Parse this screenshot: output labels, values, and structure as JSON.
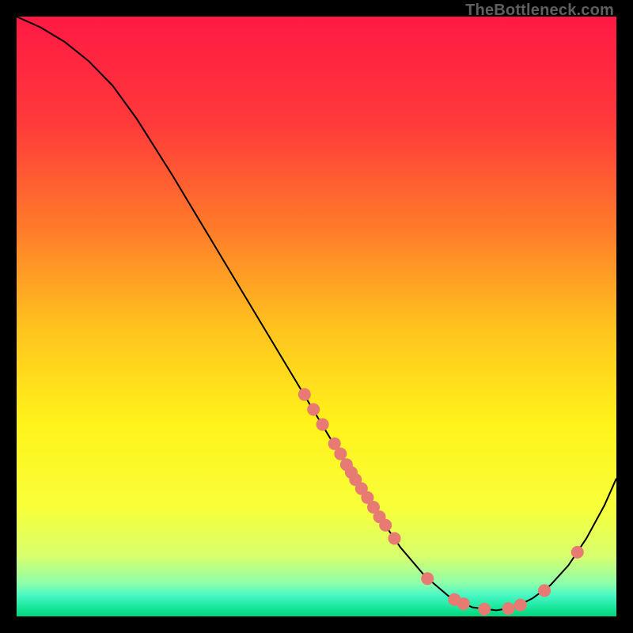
{
  "attribution": "TheBottleneck.com",
  "chart_data": {
    "type": "line",
    "title": "",
    "xlabel": "",
    "ylabel": "",
    "xlim": [
      0,
      100
    ],
    "ylim": [
      0,
      100
    ],
    "background_gradient": {
      "stops": [
        {
          "offset": 0.0,
          "color": "#ff1944"
        },
        {
          "offset": 0.18,
          "color": "#ff3a3a"
        },
        {
          "offset": 0.35,
          "color": "#ff7a2a"
        },
        {
          "offset": 0.52,
          "color": "#ffc31e"
        },
        {
          "offset": 0.68,
          "color": "#fff31a"
        },
        {
          "offset": 0.82,
          "color": "#f7ff3a"
        },
        {
          "offset": 0.9,
          "color": "#d7ff6e"
        },
        {
          "offset": 0.945,
          "color": "#8dffab"
        },
        {
          "offset": 0.965,
          "color": "#49f7c4"
        },
        {
          "offset": 0.983,
          "color": "#1de9a0"
        },
        {
          "offset": 1.0,
          "color": "#00d67a"
        }
      ]
    },
    "curve": [
      {
        "x": 0.0,
        "y": 100.0
      },
      {
        "x": 4.0,
        "y": 98.2
      },
      {
        "x": 8.0,
        "y": 95.8
      },
      {
        "x": 12.0,
        "y": 92.6
      },
      {
        "x": 16.0,
        "y": 88.5
      },
      {
        "x": 20.0,
        "y": 83.0
      },
      {
        "x": 26.0,
        "y": 73.5
      },
      {
        "x": 32.0,
        "y": 63.5
      },
      {
        "x": 38.0,
        "y": 53.5
      },
      {
        "x": 44.0,
        "y": 43.5
      },
      {
        "x": 50.0,
        "y": 33.5
      },
      {
        "x": 55.0,
        "y": 25.2
      },
      {
        "x": 60.0,
        "y": 17.3
      },
      {
        "x": 64.0,
        "y": 11.5
      },
      {
        "x": 68.0,
        "y": 6.8
      },
      {
        "x": 72.0,
        "y": 3.4
      },
      {
        "x": 76.0,
        "y": 1.5
      },
      {
        "x": 80.0,
        "y": 1.0
      },
      {
        "x": 83.0,
        "y": 1.5
      },
      {
        "x": 86.0,
        "y": 3.0
      },
      {
        "x": 89.0,
        "y": 5.2
      },
      {
        "x": 92.0,
        "y": 8.5
      },
      {
        "x": 95.0,
        "y": 13.0
      },
      {
        "x": 98.0,
        "y": 18.5
      },
      {
        "x": 100.0,
        "y": 23.0
      }
    ],
    "points": [
      {
        "x": 48.0,
        "y": 37.0
      },
      {
        "x": 49.5,
        "y": 34.5
      },
      {
        "x": 51.0,
        "y": 32.0
      },
      {
        "x": 53.0,
        "y": 28.8
      },
      {
        "x": 54.0,
        "y": 27.1
      },
      {
        "x": 55.0,
        "y": 25.3
      },
      {
        "x": 55.8,
        "y": 24.0
      },
      {
        "x": 56.5,
        "y": 22.8
      },
      {
        "x": 57.5,
        "y": 21.3
      },
      {
        "x": 58.5,
        "y": 19.8
      },
      {
        "x": 59.5,
        "y": 18.2
      },
      {
        "x": 60.5,
        "y": 16.6
      },
      {
        "x": 61.5,
        "y": 15.2
      },
      {
        "x": 63.0,
        "y": 13.0
      },
      {
        "x": 68.5,
        "y": 6.3
      },
      {
        "x": 73.0,
        "y": 2.8
      },
      {
        "x": 74.5,
        "y": 2.1
      },
      {
        "x": 78.0,
        "y": 1.2
      },
      {
        "x": 82.0,
        "y": 1.3
      },
      {
        "x": 84.0,
        "y": 1.9
      },
      {
        "x": 88.0,
        "y": 4.3
      },
      {
        "x": 93.5,
        "y": 10.7
      }
    ],
    "point_color": "#e77a72",
    "curve_color": "#000000"
  }
}
